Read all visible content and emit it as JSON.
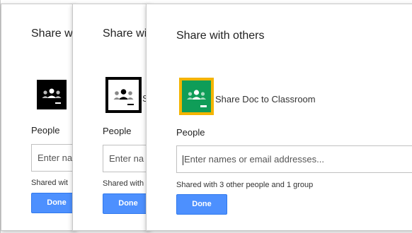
{
  "dialogs": [
    {
      "title": "Share wi",
      "item_label": "",
      "people_label": "People",
      "input_placeholder": "Enter nan",
      "shared_note": "Shared wit",
      "done_label": "Done"
    },
    {
      "title": "Share wi",
      "item_label": "Sh",
      "people_label": "People",
      "input_placeholder": "Enter na",
      "shared_note": "Shared with",
      "done_label": "Done"
    },
    {
      "title": "Share with others",
      "item_label": "Share Doc to Classroom",
      "people_label": "People",
      "input_placeholder": "Enter names or email addresses...",
      "shared_note": "Shared with 3 other people and 1 group",
      "done_label": "Done"
    }
  ],
  "icon": "google-classroom-icon",
  "colors": {
    "done_button": "#4d90fe",
    "classroom_green": "#0f9d58",
    "classroom_yellow": "#f4b400"
  }
}
